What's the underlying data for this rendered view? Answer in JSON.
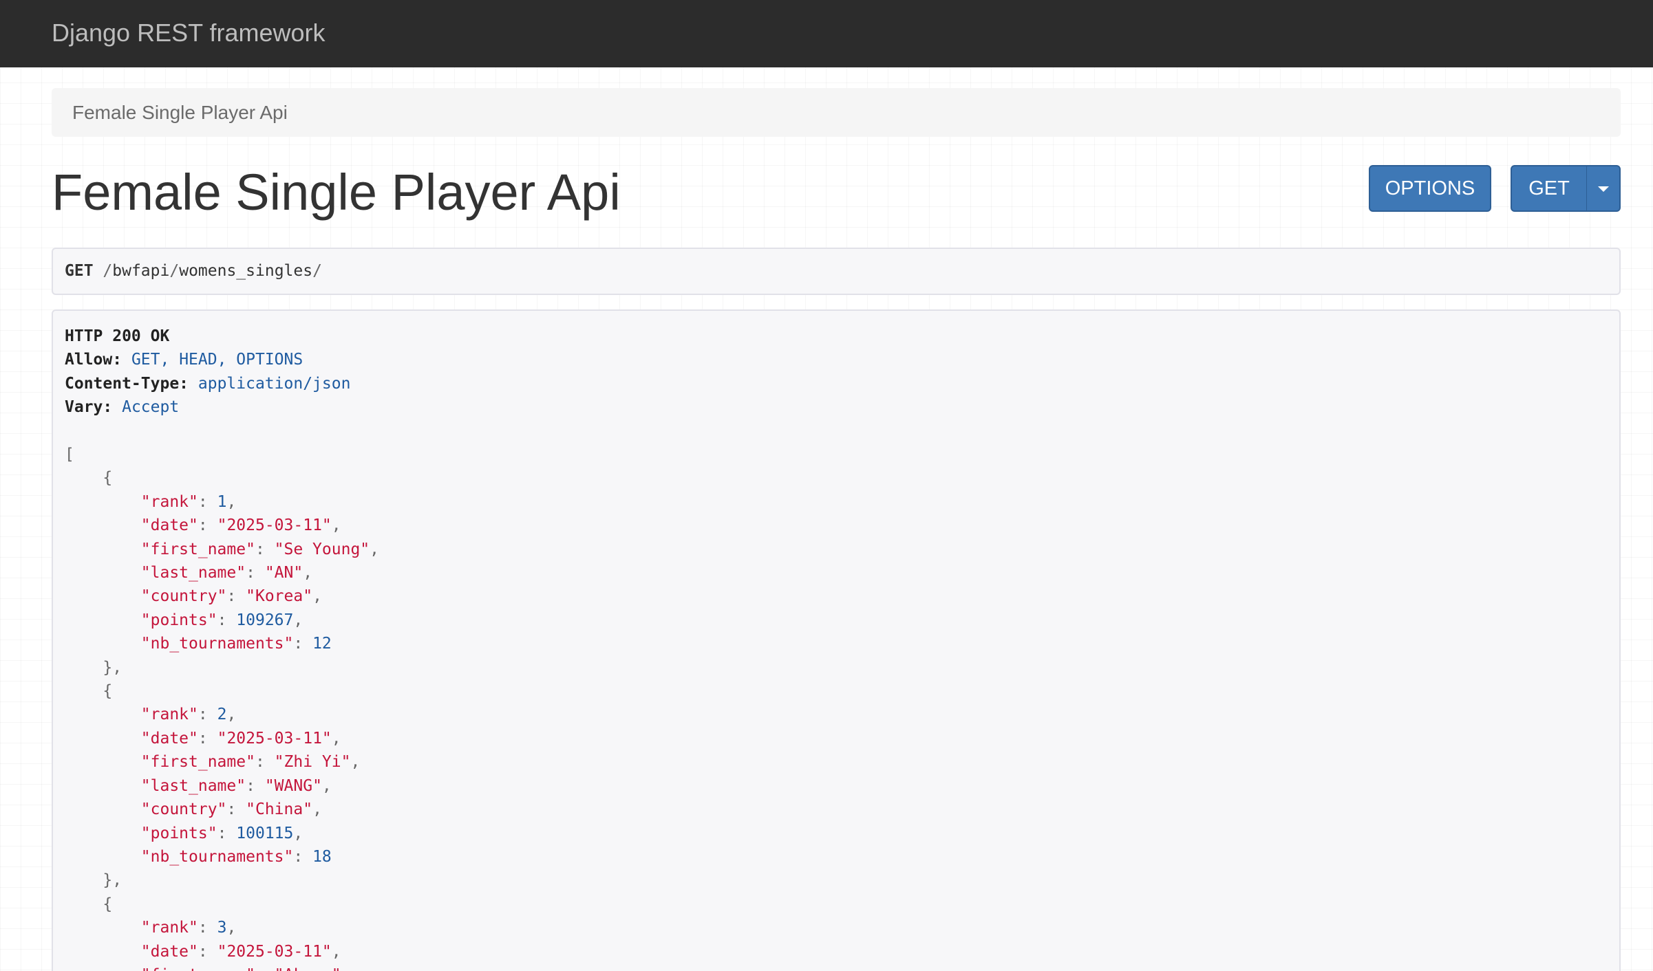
{
  "navbar": {
    "brand": "Django REST framework"
  },
  "breadcrumb": {
    "current": "Female Single Player Api"
  },
  "page": {
    "title": "Female Single Player Api"
  },
  "buttons": {
    "options_label": "OPTIONS",
    "get_label": "GET"
  },
  "request": {
    "method": "GET",
    "path_parts": [
      "/",
      "bwfapi",
      "/",
      "womens_singles",
      "/"
    ]
  },
  "response": {
    "status": "HTTP 200 OK",
    "headers": [
      {
        "key": "Allow:",
        "value": "GET, HEAD, OPTIONS"
      },
      {
        "key": "Content-Type:",
        "value": "application/json"
      },
      {
        "key": "Vary:",
        "value": "Accept"
      }
    ],
    "records": [
      {
        "rank": "1",
        "date": "\"2025-03-11\"",
        "first_name": "\"Se Young\"",
        "last_name": "\"AN\"",
        "country": "\"Korea\"",
        "points": "109267",
        "nb_tournaments": "12"
      },
      {
        "rank": "2",
        "date": "\"2025-03-11\"",
        "first_name": "\"Zhi Yi\"",
        "last_name": "\"WANG\"",
        "country": "\"China\"",
        "points": "100115",
        "nb_tournaments": "18"
      },
      {
        "rank": "3",
        "date": "\"2025-03-11\"",
        "first_name": "\"Akane\""
      }
    ]
  },
  "colors": {
    "navbar_bg": "#2c2c2c",
    "button_primary": "#3e78b6",
    "json_string": "#c4153b",
    "json_literal": "#1f5ba0"
  },
  "icons": {
    "dropdown": "caret-down-icon"
  }
}
